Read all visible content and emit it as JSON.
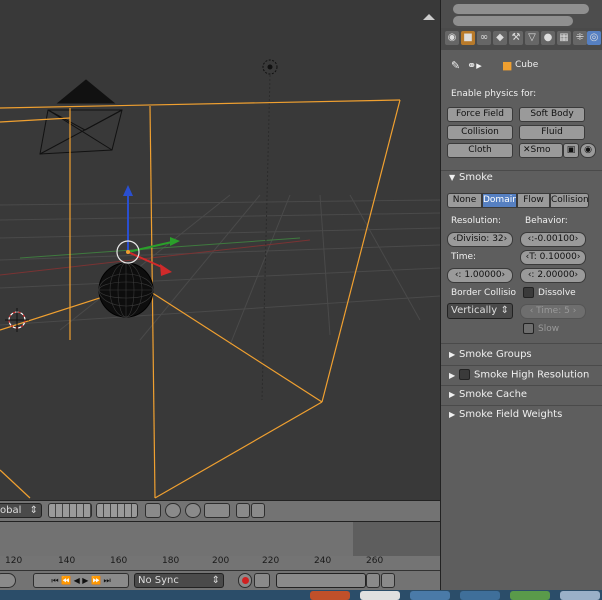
{
  "properties": {
    "object_name": "Cube",
    "enable_physics_label": "Enable physics for:",
    "physics_buttons": [
      "Force Field",
      "Soft Body",
      "Collision",
      "Fluid",
      "Cloth",
      "Smo"
    ],
    "smoke_panel_title": "Smoke",
    "smoke_types": [
      "None",
      "Domain",
      "Flow",
      "Collision"
    ],
    "smoke_type_selected": "Domain",
    "resolution_label": "Resolution:",
    "behavior_label": "Behavior:",
    "divisions_value": "Divisio: 32",
    "behavior_a_value": "-0.00100",
    "time_label": "Time:",
    "behavior_b_value": "T: 0.10000",
    "time_value": "1.00000",
    "behavior_c_value": "2.00000",
    "border_collision_label": "Border Collisio",
    "dissolve_label": "Dissolve",
    "border_select": "Vertically",
    "dissolve_time_value": "Time: 5",
    "slow_label": "Slow",
    "subpanels": [
      "Smoke Groups",
      "Smoke High Resolution",
      "Smoke Cache",
      "Smoke Field Weights"
    ]
  },
  "viewport_header": {
    "orientation_select": "obal"
  },
  "timeline": {
    "ticks": [
      "120",
      "140",
      "160",
      "180",
      "200",
      "220",
      "240",
      "260"
    ],
    "sync_select": "No Sync"
  },
  "colors": {
    "viewport_bg": "#393939",
    "selection_orange": "#f0a030",
    "accent_blue": "#5680c2"
  }
}
